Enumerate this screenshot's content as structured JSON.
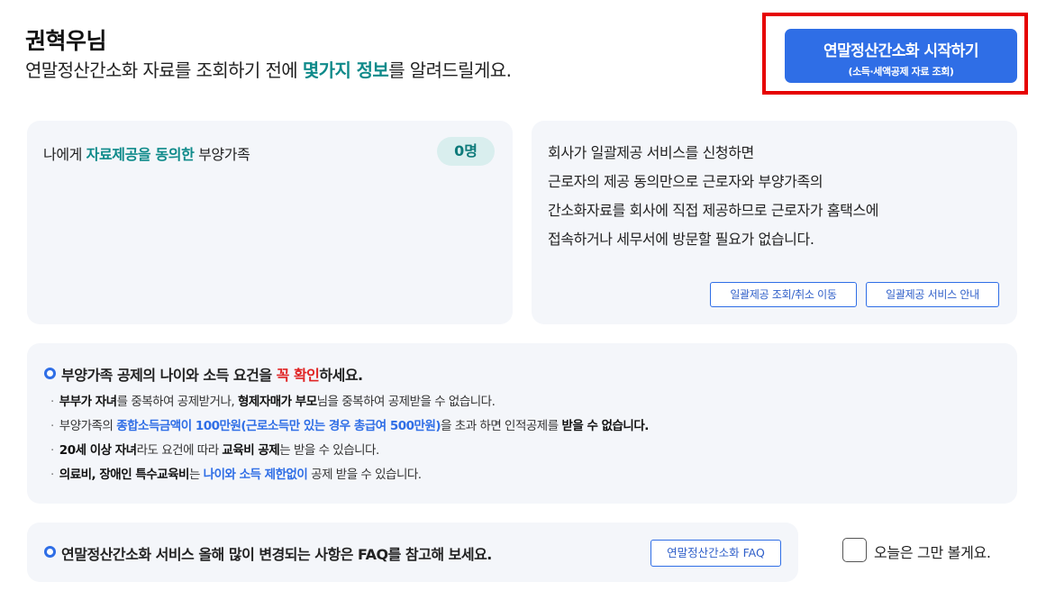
{
  "greeting": {
    "name": "권혁우님",
    "sub_prefix": "연말정산간소화 자료를 조회하기 전에 ",
    "sub_highlight": "몇가지 정보",
    "sub_suffix": "를 알려드릴게요."
  },
  "start_button": {
    "label": "연말정산간소화 시작하기",
    "sublabel": "(소득·세액공제 자료 조회)"
  },
  "dependents_card": {
    "prefix": "나에게 ",
    "highlight": "자료제공을 동의한",
    "suffix": " 부양가족",
    "count": "0명"
  },
  "bulk_card": {
    "lines": [
      "회사가 일괄제공 서비스를 신청하면",
      "근로자의 제공 동의만으로 근로자와 부양가족의",
      "간소화자료를 회사에 직접 제공하므로 근로자가 홈택스에",
      "접속하거나 세무서에 방문할 필요가 없습니다."
    ],
    "cancel_button": "일괄제공 조회/취소 이동",
    "guide_button": "일괄제공 서비스 안내"
  },
  "notice": {
    "title_prefix": "부양가족 공제의 나이와 소득 요건을 ",
    "title_highlight": "꼭 확인",
    "title_suffix": "하세요.",
    "items": [
      {
        "b1": "부부가 자녀",
        "t1": "를 중복하여 공제받거나, ",
        "b2": "형제자매가 부모",
        "t2": "님을 중복하여 공제받을 수 없습니다."
      },
      {
        "t1": "부양가족의 ",
        "h1": "종합소득금액이 100만원(근로소득만 있는 경우 총급여 500만원)",
        "t2": "을 초과 하면 인적공제를 ",
        "b1": "받을 수 없습니다."
      },
      {
        "b1": "20세 이상 자녀",
        "t1": "라도 요건에 따라 ",
        "b2": "교육비 공제",
        "t2": "는 받을 수 있습니다."
      },
      {
        "b1": "의료비, 장애인 특수교육비",
        "t1": "는 ",
        "h1": "나이와 소득 제한없이",
        "t2": " 공제 받을 수 있습니다."
      }
    ]
  },
  "faq": {
    "title": "연말정산간소화 서비스 올해 많이 변경되는 사항은 FAQ를 참고해 보세요.",
    "button": "연말정산간소화 FAQ"
  },
  "dismiss": {
    "label": "오늘은 그만 볼게요.",
    "checked": false
  },
  "colors": {
    "accent": "#2f6ee6",
    "teal": "#0e8a8a",
    "highlight_frame": "#e60000",
    "card_bg": "#f4f6fa"
  }
}
